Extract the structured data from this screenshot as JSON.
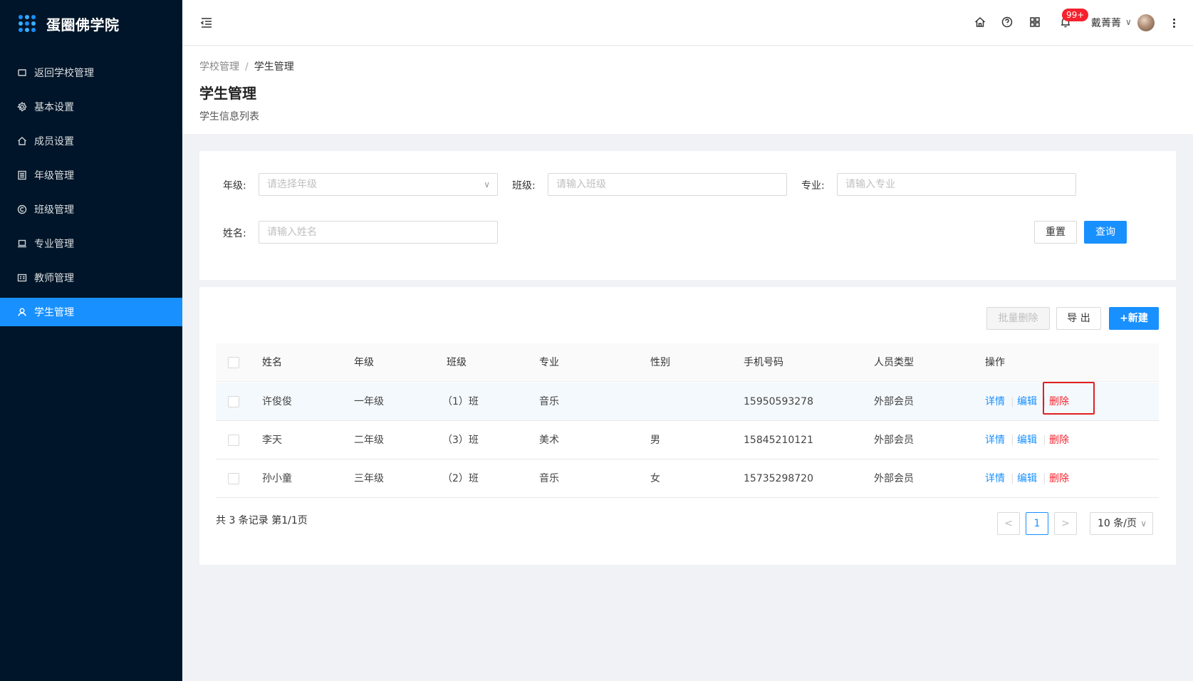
{
  "app": {
    "title": "蛋圈佛学院"
  },
  "sidebar": {
    "items": [
      {
        "label": "返回学校管理",
        "icon": "back-icon"
      },
      {
        "label": "基本设置",
        "icon": "gear-icon"
      },
      {
        "label": "成员设置",
        "icon": "home-icon"
      },
      {
        "label": "年级管理",
        "icon": "list-icon"
      },
      {
        "label": "班级管理",
        "icon": "copyright-icon"
      },
      {
        "label": "专业管理",
        "icon": "laptop-icon"
      },
      {
        "label": "教师管理",
        "icon": "id-card-icon"
      },
      {
        "label": "学生管理",
        "icon": "user-icon",
        "active": true
      }
    ]
  },
  "header": {
    "icons": [
      "home-icon",
      "question-icon",
      "apps-icon",
      "bell-icon"
    ],
    "badge": "99+",
    "user": "戴菁菁",
    "user_chevron": "∨"
  },
  "breadcrumb": {
    "parent": "学校管理",
    "separator": "/",
    "current": "学生管理"
  },
  "page": {
    "title": "学生管理",
    "subtitle": "学生信息列表"
  },
  "filters": {
    "grade": {
      "label": "年级:",
      "placeholder": "请选择年级"
    },
    "class": {
      "label": "班级:",
      "placeholder": "请输入班级"
    },
    "major": {
      "label": "专业:",
      "placeholder": "请输入专业"
    },
    "name": {
      "label": "姓名:",
      "placeholder": "请输入姓名"
    },
    "reset_label": "重置",
    "query_label": "查询"
  },
  "toolbar": {
    "batch_delete_label": "批量删除",
    "export_label": "导 出",
    "new_label": "+新建"
  },
  "table": {
    "columns": [
      "姓名",
      "年级",
      "班级",
      "专业",
      "性别",
      "手机号码",
      "人员类型",
      "操作"
    ],
    "rows": [
      {
        "name": "许俊俊",
        "grade": "一年级",
        "class": "（1）班",
        "major": "音乐",
        "gender": "",
        "phone": "15950593278",
        "type": "外部会员"
      },
      {
        "name": "李天",
        "grade": "二年级",
        "class": "（3）班",
        "major": "美术",
        "gender": "男",
        "phone": "15845210121",
        "type": "外部会员"
      },
      {
        "name": "孙小童",
        "grade": "三年级",
        "class": "（2）班",
        "major": "音乐",
        "gender": "女",
        "phone": "15735298720",
        "type": "外部会员"
      }
    ],
    "actions": {
      "detail": "详情",
      "edit": "编辑",
      "delete": "删除",
      "separator": "|"
    }
  },
  "pagination": {
    "total_text": "共 3 条记录 第1/1页",
    "prev": "<",
    "current": "1",
    "next": ">",
    "page_size": "10 条/页",
    "page_size_chevron": "∨"
  },
  "colors": {
    "primary": "#1890ff",
    "danger": "#f5222d",
    "sidebar_bg": "#001529",
    "highlight_box": "#e02020"
  }
}
